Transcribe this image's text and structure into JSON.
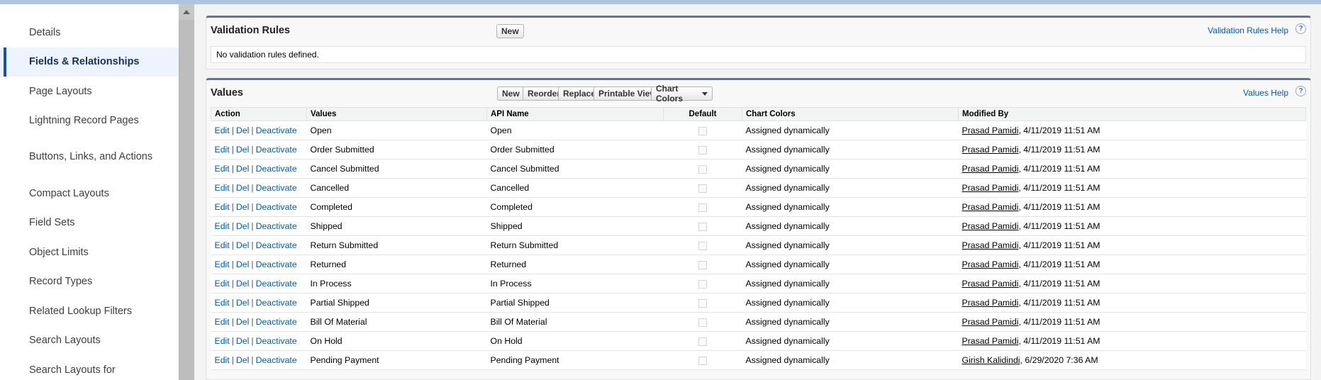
{
  "sidebar": {
    "items": [
      {
        "label": "Details",
        "active": false
      },
      {
        "label": "Fields & Relationships",
        "active": true
      },
      {
        "label": "Page Layouts",
        "active": false
      },
      {
        "label": "Lightning Record Pages",
        "active": false
      },
      {
        "label": "Buttons, Links, and Actions",
        "active": false
      },
      {
        "label": "Compact Layouts",
        "active": false
      },
      {
        "label": "Field Sets",
        "active": false
      },
      {
        "label": "Object Limits",
        "active": false
      },
      {
        "label": "Record Types",
        "active": false
      },
      {
        "label": "Related Lookup Filters",
        "active": false
      },
      {
        "label": "Search Layouts",
        "active": false
      },
      {
        "label": "Search Layouts for",
        "active": false
      }
    ]
  },
  "validation_rules": {
    "title": "Validation Rules",
    "new_label": "New",
    "help_label": "Validation Rules Help",
    "empty_text": "No validation rules defined."
  },
  "values_panel": {
    "title": "Values",
    "buttons": {
      "new": "New",
      "reorder": "Reorder",
      "replace": "Replace",
      "printable": "Printable View",
      "chart_colors": "Chart Colors"
    },
    "help_label": "Values Help",
    "columns": [
      "Action",
      "Values",
      "API Name",
      "Default",
      "Chart Colors",
      "Modified By"
    ],
    "action_labels": {
      "edit": "Edit",
      "del": "Del",
      "deactivate": "Deactivate",
      "sep": "|"
    },
    "rows": [
      {
        "value": "Open",
        "api": "Open",
        "chart": "Assigned dynamically",
        "user": "Prasad Pamidi",
        "date": ", 4/11/2019 11:51 AM"
      },
      {
        "value": "Order Submitted",
        "api": "Order Submitted",
        "chart": "Assigned dynamically",
        "user": "Prasad Pamidi",
        "date": ", 4/11/2019 11:51 AM"
      },
      {
        "value": "Cancel Submitted",
        "api": "Cancel Submitted",
        "chart": "Assigned dynamically",
        "user": "Prasad Pamidi",
        "date": ", 4/11/2019 11:51 AM"
      },
      {
        "value": "Cancelled",
        "api": "Cancelled",
        "chart": "Assigned dynamically",
        "user": "Prasad Pamidi",
        "date": ", 4/11/2019 11:51 AM"
      },
      {
        "value": "Completed",
        "api": "Completed",
        "chart": "Assigned dynamically",
        "user": "Prasad Pamidi",
        "date": ", 4/11/2019 11:51 AM"
      },
      {
        "value": "Shipped",
        "api": "Shipped",
        "chart": "Assigned dynamically",
        "user": "Prasad Pamidi",
        "date": ", 4/11/2019 11:51 AM"
      },
      {
        "value": "Return Submitted",
        "api": "Return Submitted",
        "chart": "Assigned dynamically",
        "user": "Prasad Pamidi",
        "date": ", 4/11/2019 11:51 AM"
      },
      {
        "value": "Returned",
        "api": "Returned",
        "chart": "Assigned dynamically",
        "user": "Prasad Pamidi",
        "date": ", 4/11/2019 11:51 AM"
      },
      {
        "value": "In Process",
        "api": "In Process",
        "chart": "Assigned dynamically",
        "user": "Prasad Pamidi",
        "date": ", 4/11/2019 11:51 AM"
      },
      {
        "value": "Partial Shipped",
        "api": "Partial Shipped",
        "chart": "Assigned dynamically",
        "user": "Prasad Pamidi",
        "date": ", 4/11/2019 11:51 AM"
      },
      {
        "value": "Bill Of Material",
        "api": "Bill Of Material",
        "chart": "Assigned dynamically",
        "user": "Prasad Pamidi",
        "date": ", 4/11/2019 11:51 AM"
      },
      {
        "value": "On Hold",
        "api": "On Hold",
        "chart": "Assigned dynamically",
        "user": "Prasad Pamidi",
        "date": ", 4/11/2019 11:51 AM"
      },
      {
        "value": "Pending Payment",
        "api": "Pending Payment",
        "chart": "Assigned dynamically",
        "user": "Girish Kalidindi",
        "date": ", 6/29/2020 7:36 AM"
      }
    ]
  },
  "icons": {
    "help": "question-mark-icon",
    "dropdown": "chevron-down-icon",
    "scroll_up": "arrow-up-icon"
  },
  "colors": {
    "accent": "#1b5297",
    "link": "#015ba7",
    "panel_border": "#66728f",
    "backdrop": "#b0c4df"
  }
}
